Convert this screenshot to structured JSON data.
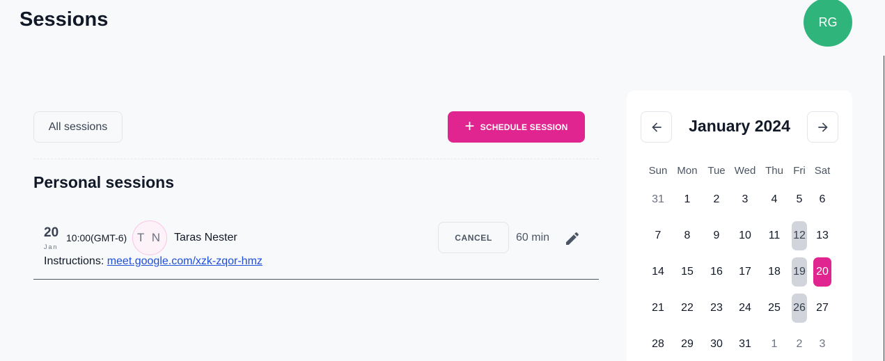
{
  "header": {
    "title": "Sessions",
    "avatar_initials": "RG"
  },
  "toolbar": {
    "filter_label": "All sessions",
    "schedule_label": "SCHEDULE SESSION"
  },
  "personal": {
    "title": "Personal sessions",
    "sessions": [
      {
        "day": "20",
        "month": "Jan",
        "time": "10:00(GMT-6)",
        "initials": "T N",
        "name": "Taras Nester",
        "instructions_label": "Instructions: ",
        "link": "meet.google.com/xzk-zqor-hmz",
        "cancel_label": "CANCEL",
        "duration": "60 min"
      }
    ]
  },
  "calendar": {
    "title": "January 2024",
    "weekdays": [
      "Sun",
      "Mon",
      "Tue",
      "Wed",
      "Thu",
      "Fri",
      "Sat"
    ],
    "weeks": [
      [
        "31",
        "1",
        "2",
        "3",
        "4",
        "5",
        "6"
      ],
      [
        "7",
        "8",
        "9",
        "10",
        "11",
        "12",
        "13"
      ],
      [
        "14",
        "15",
        "16",
        "17",
        "18",
        "19",
        "20"
      ],
      [
        "21",
        "22",
        "23",
        "24",
        "25",
        "26",
        "27"
      ],
      [
        "28",
        "29",
        "30",
        "31",
        "1",
        "2",
        "3"
      ]
    ],
    "muted_days": [
      "0-0",
      "4-4",
      "4-5",
      "4-6"
    ],
    "highlighted_days": [
      "1-5",
      "2-5",
      "3-5"
    ],
    "selected_day": "2-6"
  },
  "colors": {
    "accent": "#e02590",
    "avatar": "#2fb57c",
    "highlight": "#d1d5db"
  },
  "icons": [
    "plus-icon",
    "edit-icon",
    "arrow-left-icon",
    "arrow-right-icon"
  ]
}
